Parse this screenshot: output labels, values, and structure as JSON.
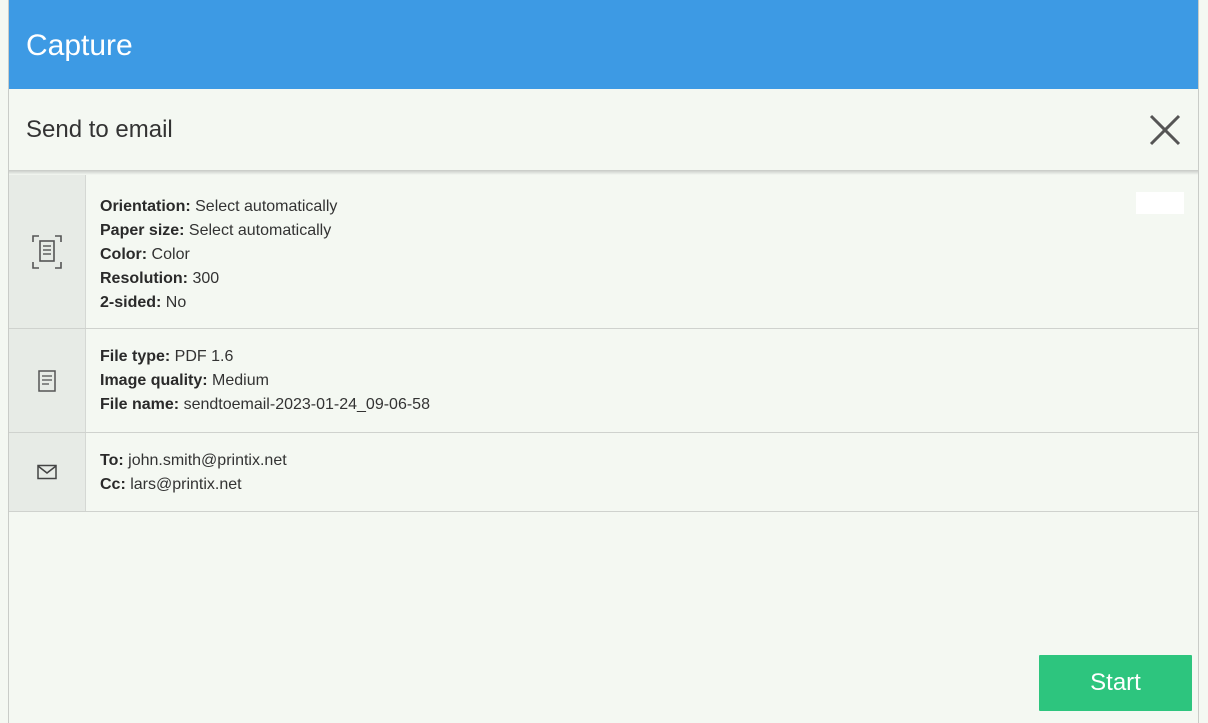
{
  "app": {
    "title": "Capture"
  },
  "dialog": {
    "title": "Send to email",
    "close_icon": "close-icon"
  },
  "scan_settings": {
    "icon": "scan-document-icon",
    "items": [
      {
        "label": "Orientation:",
        "value": " Select automatically"
      },
      {
        "label": "Paper size:",
        "value": " Select automatically"
      },
      {
        "label": "Color:",
        "value": " Color"
      },
      {
        "label": "Resolution:",
        "value": " 300"
      },
      {
        "label": "2-sided:",
        "value": " No"
      }
    ]
  },
  "file_settings": {
    "icon": "document-icon",
    "items": [
      {
        "label": "File type:",
        "value": " PDF 1.6"
      },
      {
        "label": "Image quality:",
        "value": " Medium"
      },
      {
        "label": "File name:",
        "value": " sendtoemail-2023-01-24_09-06-58"
      }
    ]
  },
  "email_settings": {
    "icon": "envelope-icon",
    "items": [
      {
        "label": "To:",
        "value": " john.smith@printix.net"
      },
      {
        "label": "Cc:",
        "value": " lars@printix.net"
      }
    ]
  },
  "actions": {
    "start_label": "Start"
  },
  "colors": {
    "header": "#3d9ae4",
    "start": "#2dc57e",
    "background": "#f4f8f2"
  }
}
